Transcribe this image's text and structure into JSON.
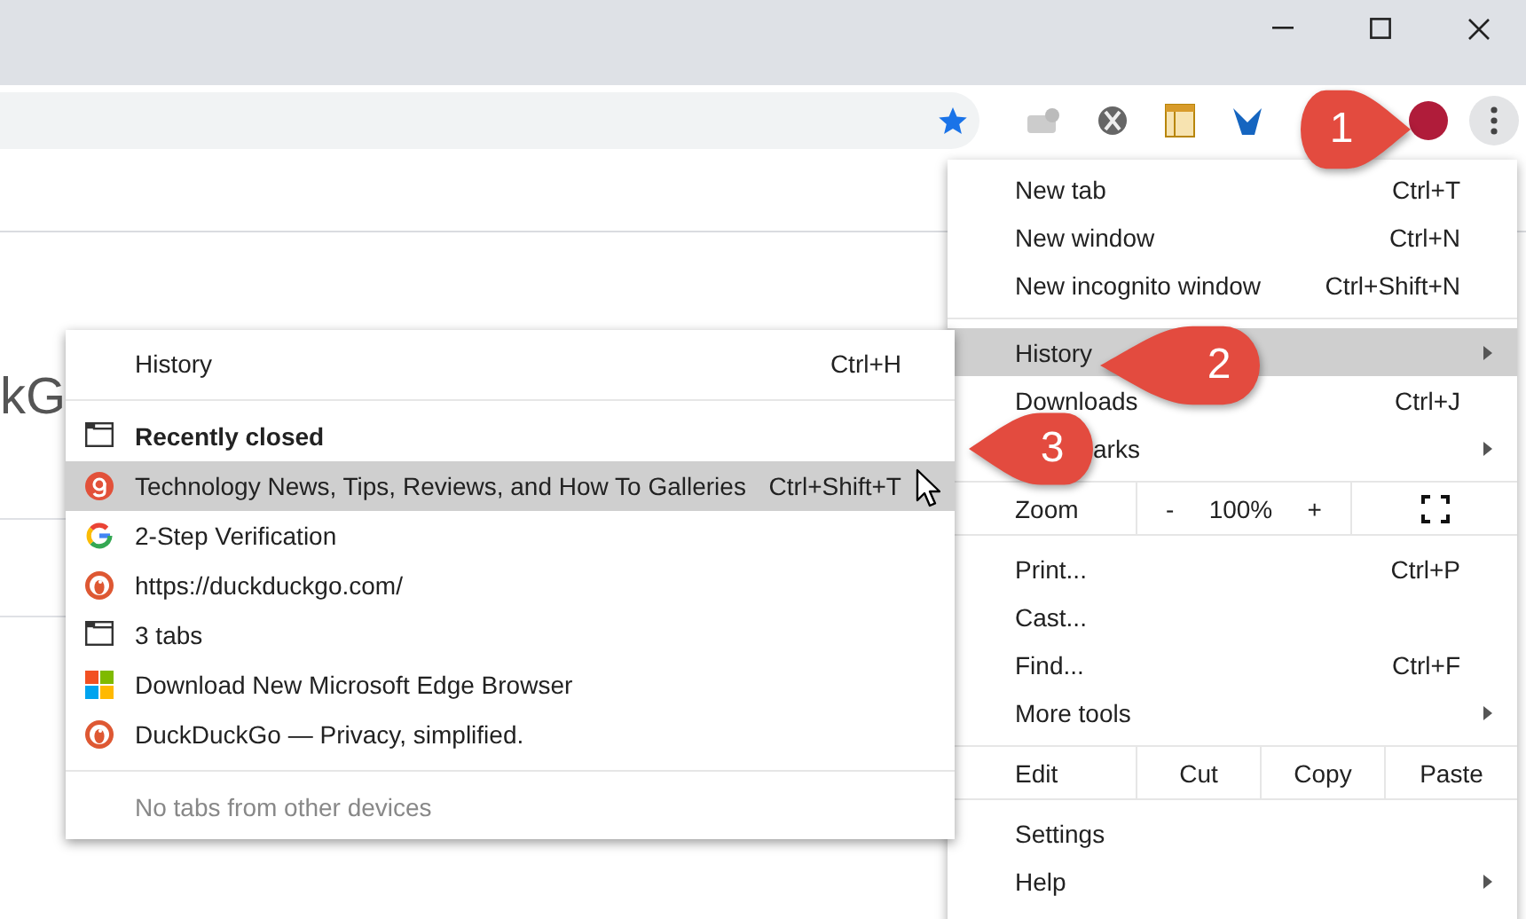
{
  "page": {
    "logo_text": "kG"
  },
  "menu": {
    "items": [
      {
        "kind": "item",
        "label": "New tab",
        "shortcut": "Ctrl+T",
        "selected": false,
        "submenu": false
      },
      {
        "kind": "item",
        "label": "New window",
        "shortcut": "Ctrl+N",
        "selected": false,
        "submenu": false
      },
      {
        "kind": "item",
        "label": "New incognito window",
        "shortcut": "Ctrl+Shift+N",
        "selected": false,
        "submenu": false
      },
      {
        "kind": "separator"
      },
      {
        "kind": "item",
        "label": "History",
        "selected": true,
        "submenu": true
      },
      {
        "kind": "item",
        "label": "Downloads",
        "shortcut": "Ctrl+J",
        "selected": false,
        "submenu": false
      },
      {
        "kind": "item",
        "label": "arks",
        "selected": false,
        "submenu": true,
        "covered": true
      },
      {
        "kind": "separator"
      },
      {
        "kind": "zoom",
        "label": "Zoom",
        "minus": "-",
        "value": "100%",
        "plus": "+"
      },
      {
        "kind": "separator"
      },
      {
        "kind": "item",
        "label": "Print...",
        "shortcut": "Ctrl+P",
        "selected": false,
        "submenu": false
      },
      {
        "kind": "item",
        "label": "Cast...",
        "selected": false,
        "submenu": false
      },
      {
        "kind": "item",
        "label": "Find...",
        "shortcut": "Ctrl+F",
        "selected": false,
        "submenu": false
      },
      {
        "kind": "item",
        "label": "More tools",
        "selected": false,
        "submenu": true
      },
      {
        "kind": "separator"
      },
      {
        "kind": "edit",
        "label": "Edit",
        "buttons": [
          "Cut",
          "Copy",
          "Paste"
        ]
      },
      {
        "kind": "separator"
      },
      {
        "kind": "item",
        "label": "Settings",
        "selected": false,
        "submenu": false
      },
      {
        "kind": "item",
        "label": "Help",
        "selected": false,
        "submenu": true
      }
    ]
  },
  "submenu": {
    "items": [
      {
        "kind": "item",
        "label": "History",
        "shortcut": "Ctrl+H",
        "selected": false
      },
      {
        "kind": "separator"
      },
      {
        "kind": "header",
        "label": "Recently closed"
      },
      {
        "kind": "page",
        "label": "Technology News, Tips, Reviews, and How To Galleries",
        "shortcut": "Ctrl+Shift+T",
        "selected": true
      },
      {
        "kind": "page",
        "label": "2-Step Verification",
        "selected": false
      },
      {
        "kind": "page",
        "label": "https://duckduckgo.com/",
        "selected": false
      },
      {
        "kind": "tabs",
        "label": "3 tabs",
        "selected": false
      },
      {
        "kind": "page",
        "label": "Download New Microsoft Edge Browser",
        "selected": false
      },
      {
        "kind": "page",
        "label": "DuckDuckGo — Privacy, simplified.",
        "selected": false
      },
      {
        "kind": "separator"
      },
      {
        "kind": "note",
        "label": "No tabs from other devices"
      }
    ]
  },
  "callouts": [
    {
      "number": "1"
    },
    {
      "number": "2"
    },
    {
      "number": "3"
    }
  ]
}
